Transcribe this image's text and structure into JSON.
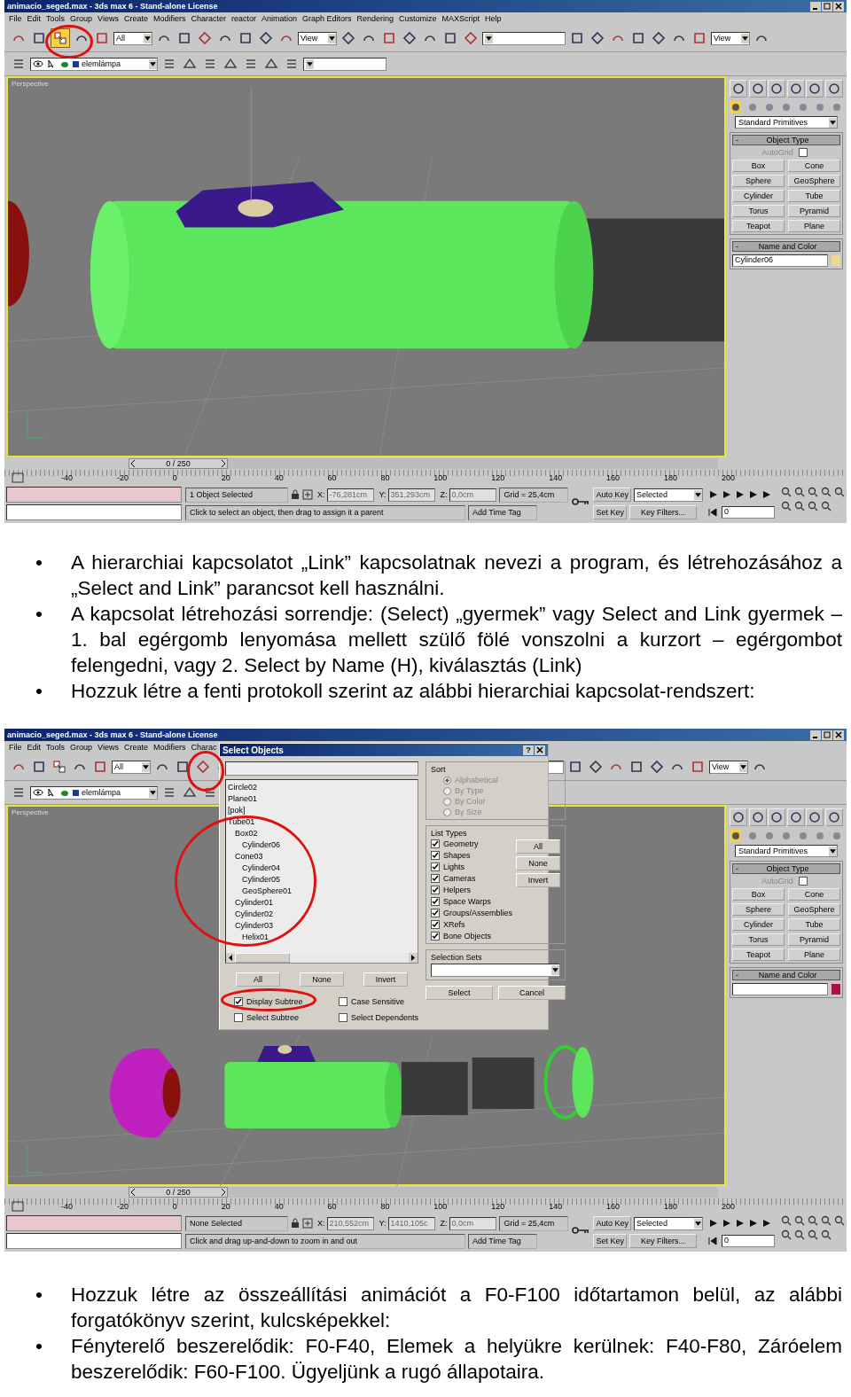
{
  "screens": [
    {
      "title": "animacio_seged.max - 3ds max 6 - Stand-alone License",
      "menu": [
        "File",
        "Edit",
        "Tools",
        "Group",
        "Views",
        "Create",
        "Modifiers",
        "Character",
        "reactor",
        "Animation",
        "Graph Editors",
        "Rendering",
        "Customize",
        "MAXScript",
        "Help"
      ],
      "link_tool_active": true,
      "filter": "All",
      "ref_coord": "View",
      "view_dropdown": "View",
      "layer": "elemlámpa",
      "viewport_label": "Perspective",
      "time_slider": {
        "label": "0 / 250",
        "level": 0
      },
      "ruler": [
        "-40",
        "-20",
        "0",
        "20",
        "40",
        "60",
        "80",
        "100",
        "120",
        "140",
        "160",
        "180",
        "200"
      ],
      "panel": {
        "category": "Standard Primitives",
        "object_type": {
          "sign": "-",
          "title": "Object Type"
        },
        "autogrid": "AutoGrid",
        "autogrid_checked": false,
        "buttons": [
          "Box",
          "Cone",
          "Sphere",
          "GeoSphere",
          "Cylinder",
          "Tube",
          "Torus",
          "Pyramid",
          "Teapot",
          "Plane"
        ],
        "name_color": {
          "sign": "-",
          "title": "Name and Color"
        },
        "name_value": "Cylinder06",
        "color": "#ecd99a"
      },
      "status": {
        "selection": "1 Object Selected",
        "x_label": "X:",
        "x": "-76,281cm",
        "y_label": "Y:",
        "y": "351,293cm",
        "z_label": "Z:",
        "z": "0,0cm",
        "grid": "Grid = 25,4cm",
        "prompt": "Click to select an object, then drag to assign it a parent",
        "time_tag": "Add Time Tag",
        "auto_key": "Auto Key",
        "key_mode": "Selected",
        "set_key": "Set Key",
        "key_filters": "Key Filters...",
        "frame": "0"
      }
    },
    {
      "title": "animacio_seged.max - 3ds max 6 - Stand-alone License",
      "menu": [
        "File",
        "Edit",
        "Tools",
        "Group",
        "Views",
        "Create",
        "Modifiers",
        "Charac"
      ],
      "link_tool_active": false,
      "filter": "All",
      "view_dropdown": "View",
      "layer": "elemlámpa",
      "viewport_label": "Perspective",
      "time_slider": {
        "label": "0 / 250",
        "level": 0
      },
      "ruler": [
        "-40",
        "-20",
        "0",
        "20",
        "40",
        "60",
        "80",
        "100",
        "120",
        "140",
        "160",
        "180",
        "200"
      ],
      "panel": {
        "category": "Standard Primitives",
        "object_type": {
          "sign": "-",
          "title": "Object Type"
        },
        "autogrid": "AutoGrid",
        "autogrid_checked": false,
        "buttons": [
          "Box",
          "Cone",
          "Sphere",
          "GeoSphere",
          "Cylinder",
          "Tube",
          "Torus",
          "Pyramid",
          "Teapot",
          "Plane"
        ],
        "name_color": {
          "sign": "-",
          "title": "Name and Color"
        },
        "color": "#b01040"
      },
      "status": {
        "selection": "None Selected",
        "x_label": "X:",
        "x": "210,552cm",
        "y_label": "Y:",
        "y": "1410,105c",
        "z_label": "Z:",
        "z": "0,0cm",
        "grid": "Grid = 25,4cm",
        "prompt": "Click and drag up-and-down to zoom in and out",
        "time_tag": "Add Time Tag",
        "auto_key": "Auto Key",
        "key_mode": "Selected",
        "set_key": "Set Key",
        "key_filters": "Key Filters...",
        "frame": "0"
      },
      "dialog": {
        "title": "Select Objects",
        "help": "?",
        "tree": [
          {
            "name": "Circle02"
          },
          {
            "name": "Plane01"
          },
          {
            "name": "[pok]"
          },
          {
            "name": "Tube01",
            "children": [
              {
                "name": "Box02",
                "children": [
                  {
                    "name": "Cylinder06"
                  }
                ]
              },
              {
                "name": "Cone03",
                "children": [
                  {
                    "name": "Cylinder04"
                  },
                  {
                    "name": "Cylinder05"
                  },
                  {
                    "name": "GeoSphere01"
                  }
                ]
              },
              {
                "name": "Cylinder01"
              },
              {
                "name": "Cylinder02"
              },
              {
                "name": "Cylinder03",
                "children": [
                  {
                    "name": "Helix01"
                  }
                ]
              }
            ]
          }
        ],
        "list_buttons": [
          "All",
          "None",
          "Invert"
        ],
        "options": [
          {
            "label": "Display Subtree",
            "checked": true
          },
          {
            "label": "Case Sensitive",
            "checked": false
          },
          {
            "label": "Select Subtree",
            "checked": false
          },
          {
            "label": "Select Dependents",
            "checked": false
          }
        ],
        "sort_title": "Sort",
        "sort": [
          {
            "label": "Alphabetical",
            "selected": true
          },
          {
            "label": "By Type",
            "selected": false
          },
          {
            "label": "By Color",
            "selected": false
          },
          {
            "label": "By Size",
            "selected": false
          }
        ],
        "list_types_title": "List Types",
        "list_types": [
          {
            "label": "Geometry",
            "checked": true
          },
          {
            "label": "Shapes",
            "checked": true
          },
          {
            "label": "Lights",
            "checked": true
          },
          {
            "label": "Cameras",
            "checked": true
          },
          {
            "label": "Helpers",
            "checked": true
          },
          {
            "label": "Space Warps",
            "checked": true
          },
          {
            "label": "Groups/Assemblies",
            "checked": true
          },
          {
            "label": "XRefs",
            "checked": true
          },
          {
            "label": "Bone Objects",
            "checked": true
          }
        ],
        "type_buttons": [
          "All",
          "None",
          "Invert"
        ],
        "sets_title": "Selection Sets",
        "select": "Select",
        "cancel": "Cancel"
      }
    }
  ],
  "bullets_1": [
    {
      "marker": "•",
      "text": "A hierarchiai kapcsolatot „Link” kapcsolatnak nevezi a program, és létrehozásához a „Select and Link” parancsot kell használni."
    },
    {
      "marker": "•",
      "text": "A kapcsolat létrehozási sorrendje: (Select) „gyermek” vagy Select and Link gyermek – 1. bal egérgomb lenyomása mellett szülő fölé vonszolni a kurzort – egérgombot felengedni, vagy 2. Select by Name (H), kiválasztás (Link)"
    },
    {
      "marker": "•",
      "text": "Hozzuk létre a fenti protokoll szerint az alábbi hierarchiai kapcsolat-rendszert:"
    }
  ],
  "bullets_2": [
    {
      "marker": "•",
      "text": "Hozzuk létre az összeállítási animációt a F0-F100 időtartamon belül, az alábbi forgatókönyv szerint, kulcsképekkel:"
    },
    {
      "marker": "•",
      "text": "Fényterelő beszerelődik: F0-F40, Elemek a helyükre kerülnek: F40-F80, Záróelem beszerelődik: F60-F100. Ügyeljünk a rugó állapotaira."
    }
  ]
}
